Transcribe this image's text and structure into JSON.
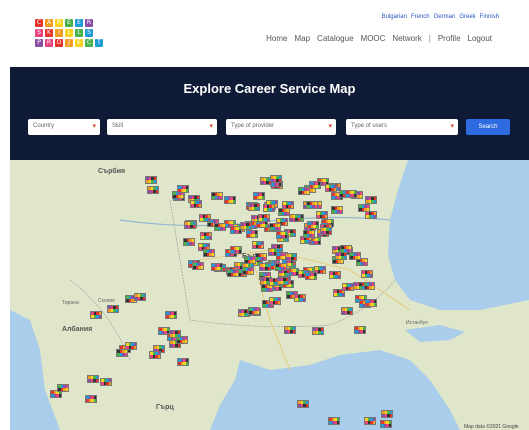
{
  "header": {
    "logo_letters": [
      "C",
      "A",
      "R",
      "E",
      "E",
      "R",
      "S",
      "K",
      "I",
      "L",
      "L",
      "S",
      "P",
      "R",
      "O",
      "J",
      "E",
      "C",
      "T"
    ],
    "languages": [
      "Bulgarian",
      "French",
      "German",
      "Greek",
      "Finnish"
    ],
    "nav": [
      "Home",
      "Map",
      "Catalogue",
      "MOOC",
      "Network",
      "Profile",
      "Logout"
    ]
  },
  "banner": {
    "title": "Explore Career Service Map",
    "filters": [
      "Country",
      "Skill",
      "Type of provider",
      "Type of users"
    ],
    "search_label": "Search"
  },
  "map": {
    "labels": {
      "serbia": "Сърбия",
      "bulgaria": "Бълга",
      "albania": "Албания",
      "greece": "Гърц",
      "tirana": "Тирана",
      "skopje": "Скопие",
      "istanbul": "Истанбул"
    },
    "attribution": "Map data ©2021 Google"
  },
  "colors": {
    "banner_bg": "#0f1b36",
    "button": "#2f6be0",
    "sea": "#a9cdea",
    "land": "#dfe6c9",
    "link": "#2b55c4"
  }
}
